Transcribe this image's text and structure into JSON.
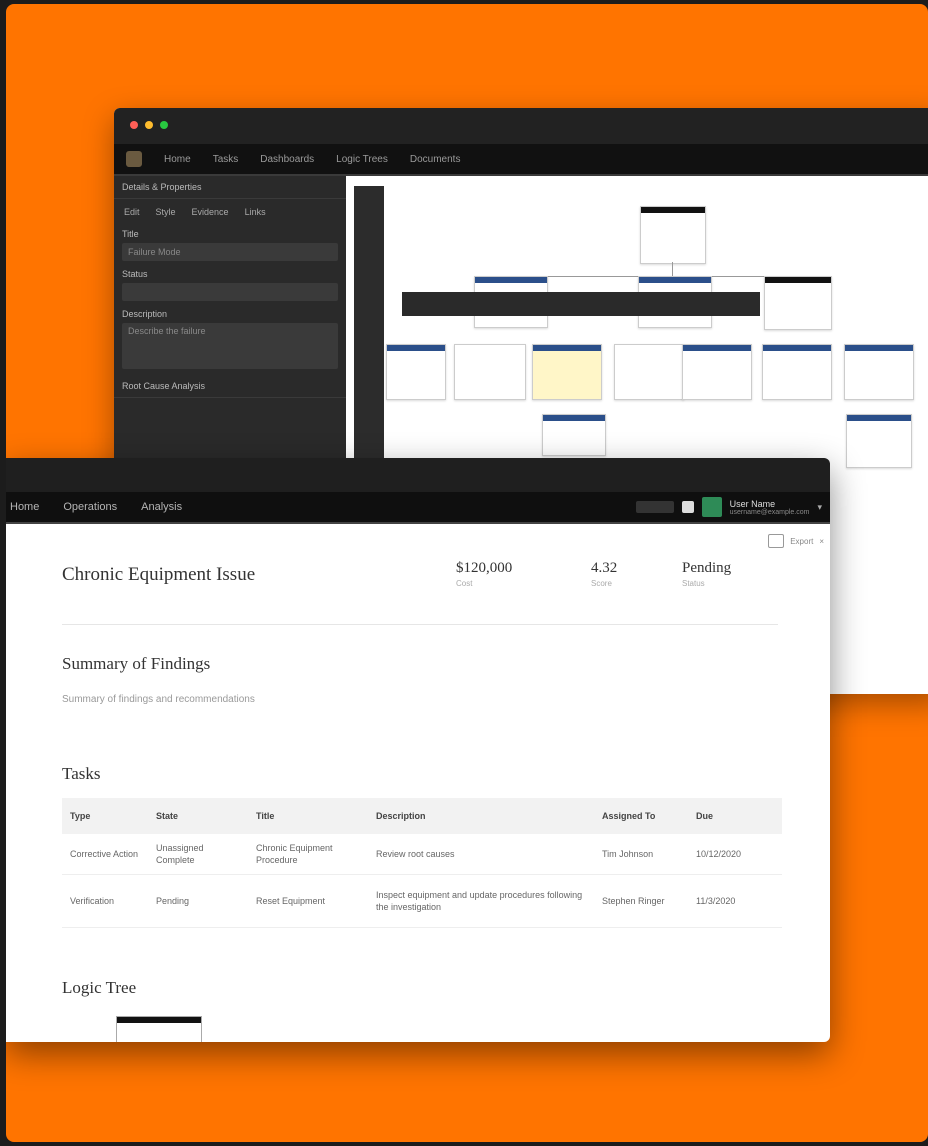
{
  "back_window": {
    "nav": [
      "Home",
      "Tasks",
      "Dashboards",
      "Logic Trees",
      "Documents"
    ],
    "sidebar": {
      "header": "Details & Properties",
      "tabs": [
        "Edit",
        "Style",
        "Evidence",
        "Links"
      ],
      "field1_label": "Title",
      "field1_value": "Failure Mode",
      "field2_label": "Status",
      "field2_value": "",
      "field3_label": "Description",
      "field3_value": "Describe the failure",
      "field4_label": "Root Cause Analysis"
    }
  },
  "front_window": {
    "nav": [
      "Home",
      "Operations",
      "Analysis"
    ],
    "user": {
      "name": "User Name",
      "subtitle": "username@example.com"
    },
    "toolbar_right": "Export",
    "page_title": "Chronic Equipment Issue",
    "metrics": [
      {
        "value": "$120,000",
        "label": "Cost"
      },
      {
        "value": "4.32",
        "label": "Score"
      },
      {
        "value": "Pending",
        "label": "Status"
      }
    ],
    "summary_title": "Summary of Findings",
    "summary_text": "Summary of findings and recommendations",
    "tasks_title": "Tasks",
    "tasks_columns": [
      "Type",
      "State",
      "Title",
      "Description",
      "Assigned To",
      "Due"
    ],
    "tasks_rows": [
      [
        "Corrective Action",
        "Unassigned Complete",
        "Chronic Equipment Procedure",
        "Review root causes",
        "Tim Johnson",
        "10/12/2020"
      ],
      [
        "Verification",
        "Pending",
        "Reset Equipment",
        "Inspect equipment and update procedures following the investigation",
        "Stephen Ringer",
        "11/3/2020"
      ]
    ],
    "logic_tree_title": "Logic Tree"
  },
  "colors": {
    "background": "#ff7400",
    "window_chrome": "#1f1f1f",
    "accent_header": "#2b4f8a"
  }
}
